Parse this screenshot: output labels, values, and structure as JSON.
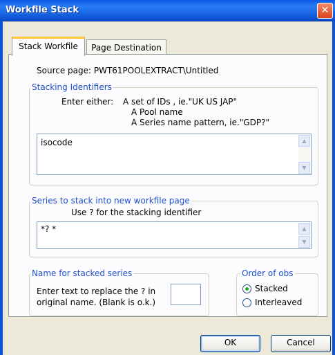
{
  "window": {
    "title": "Workfile Stack",
    "close_glyph": "✕"
  },
  "tabs": [
    {
      "label": "Stack Workfile",
      "active": true
    },
    {
      "label": "Page Destination",
      "active": false
    }
  ],
  "source_page": "Source page: PWT61POOLEXTRACT\\Untitled",
  "stacking": {
    "legend": "Stacking Identifiers",
    "enter_either": "Enter either:",
    "option1": "A set of IDs ,  ie.\"UK US JAP\"",
    "option2": "A Pool name",
    "option3": "A Series name pattern,  ie.\"GDP?\"",
    "value": "isocode"
  },
  "series": {
    "legend": "Series to stack into new workfile page",
    "hint": "Use ? for the stacking identifier",
    "value": "*? *"
  },
  "name_group": {
    "legend": "Name for stacked series",
    "line1": "Enter text to replace the ? in",
    "line2": "original name. (Blank is o.k.)",
    "value": ""
  },
  "order": {
    "legend": "Order of obs",
    "options": [
      {
        "label": "Stacked",
        "selected": true
      },
      {
        "label": "Interleaved",
        "selected": false
      }
    ]
  },
  "buttons": {
    "ok": "OK",
    "cancel": "Cancel"
  },
  "icons": {
    "up": "▲",
    "down": "▼"
  },
  "colors": {
    "titlebar": "#0a59e6",
    "legend_text": "#1e50c8",
    "active_tab_accent": "#ffc73c"
  }
}
